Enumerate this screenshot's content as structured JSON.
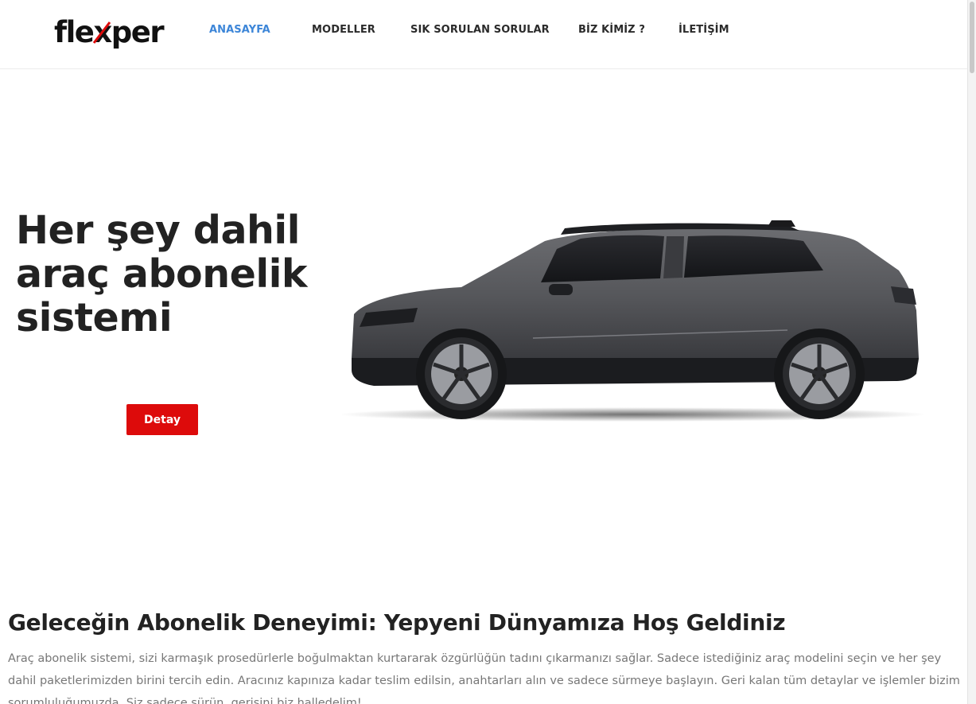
{
  "brand": {
    "logo_text": "flexper",
    "accent": "#dd0b0b"
  },
  "nav": {
    "items": [
      {
        "label": "ANASAYFA",
        "active": true
      },
      {
        "label": "MODELLER",
        "active": false
      },
      {
        "label": "SIK SORULAN SORULAR",
        "active": false
      },
      {
        "label": "BİZ KİMİZ ?",
        "active": false
      },
      {
        "label": "İLETİŞİM",
        "active": false
      }
    ],
    "active_color": "#3d86d8"
  },
  "hero": {
    "title": "Her şey dahil araç abonelik sistemi",
    "button_label": "Detay",
    "image": "car-side-view-image"
  },
  "welcome": {
    "title": "Geleceğin Abonelik Deneyimi: Yepyeni Dünyamıza Hoş Geldiniz",
    "text": "Araç abonelik sistemi, sizi karmaşık prosedürlerle boğulmaktan kurtararak özgürlüğün tadını çıkarmanızı sağlar. Sadece istediğiniz araç modelini seçin ve her şey dahil paketlerimizden birini tercih edin. Aracınız kapınıza kadar teslim edilsin, anahtarları alın ve sadece sürmeye başlayın. Geri kalan tüm detaylar ve işlemler bizim sorumluluğumuzda. Siz sadece sürün, gerisini biz halledelim!"
  }
}
